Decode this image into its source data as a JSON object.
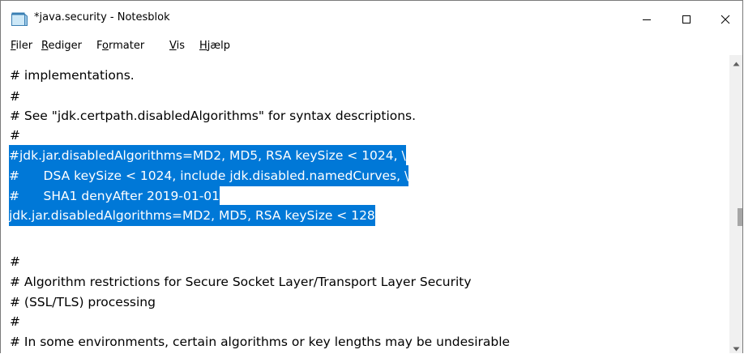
{
  "window": {
    "title": "*java.security - Notesblok",
    "controls": [
      "minimize-icon",
      "maximize-icon",
      "close-icon"
    ]
  },
  "menu": [
    {
      "mnemonic": "F",
      "rest": "iler"
    },
    {
      "mnemonic": "R",
      "rest": "ediger"
    },
    {
      "pre": "F",
      "mnemonic": "o",
      "rest": "rmater"
    },
    {
      "mnemonic": "V",
      "rest": "is"
    },
    {
      "mnemonic": "H",
      "rest": "jælp"
    }
  ],
  "editor": {
    "lines": [
      "# implementations.",
      "#",
      "# See \"jdk.certpath.disabledAlgorithms\" for syntax descriptions.",
      "#",
      "#jdk.jar.disabledAlgorithms=MD2, MD5, RSA keySize < 1024, \\",
      "#      DSA keySize < 1024, include jdk.disabled.namedCurves, \\",
      "#      SHA1 denyAfter 2019-01-01",
      "jdk.jar.disabledAlgorithms=MD2, MD5, RSA keySize < 128",
      "",
      "#",
      "# Algorithm restrictions for Secure Socket Layer/Transport Layer Security",
      "# (SSL/TLS) processing",
      "#",
      "# In some environments, certain algorithms or key lengths may be undesirable"
    ],
    "selected_lines": [
      4,
      5,
      6,
      7
    ],
    "selection_color": "#0078d7"
  }
}
